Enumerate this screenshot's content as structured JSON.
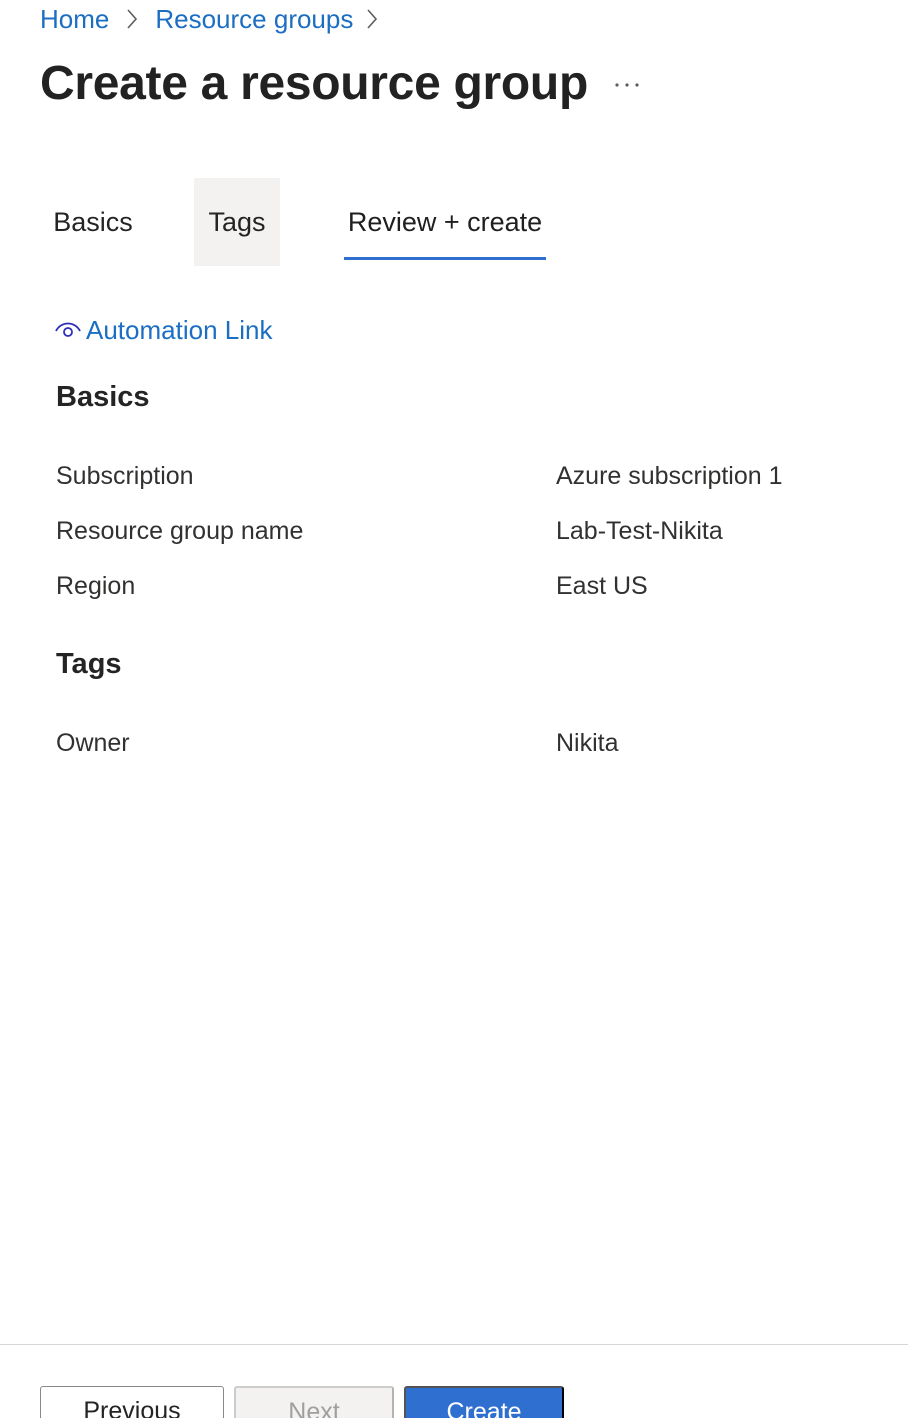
{
  "breadcrumb": {
    "items": [
      "Home",
      "Resource groups"
    ],
    "separator_icon": "chevron-right-icon"
  },
  "page": {
    "title": "Create a resource group",
    "more_icon": "ellipsis-icon"
  },
  "tabs": [
    {
      "label": "Basics",
      "state": "default"
    },
    {
      "label": "Tags",
      "state": "hover"
    },
    {
      "label": "Review + create",
      "state": "selected"
    }
  ],
  "automation": {
    "label": "Automation Link",
    "icon": "eye-icon"
  },
  "basics": {
    "heading": "Basics",
    "rows": [
      {
        "label": "Subscription",
        "value": "Azure subscription 1"
      },
      {
        "label": "Resource group name",
        "value": "Lab-Test-Nikita"
      },
      {
        "label": "Region",
        "value": "East US"
      }
    ]
  },
  "tags": {
    "heading": "Tags",
    "rows": [
      {
        "label": "Owner",
        "value": "Nikita"
      }
    ]
  },
  "footer": {
    "previous_label": "Previous",
    "next_label": "Next",
    "create_label": "Create",
    "next_enabled": false
  },
  "colors": {
    "link": "#1b6ec2",
    "accent": "#2f6fd0",
    "tab_hover_bg": "#f3f2f1",
    "text": "#242424",
    "disabled_text": "#a19f9d"
  }
}
